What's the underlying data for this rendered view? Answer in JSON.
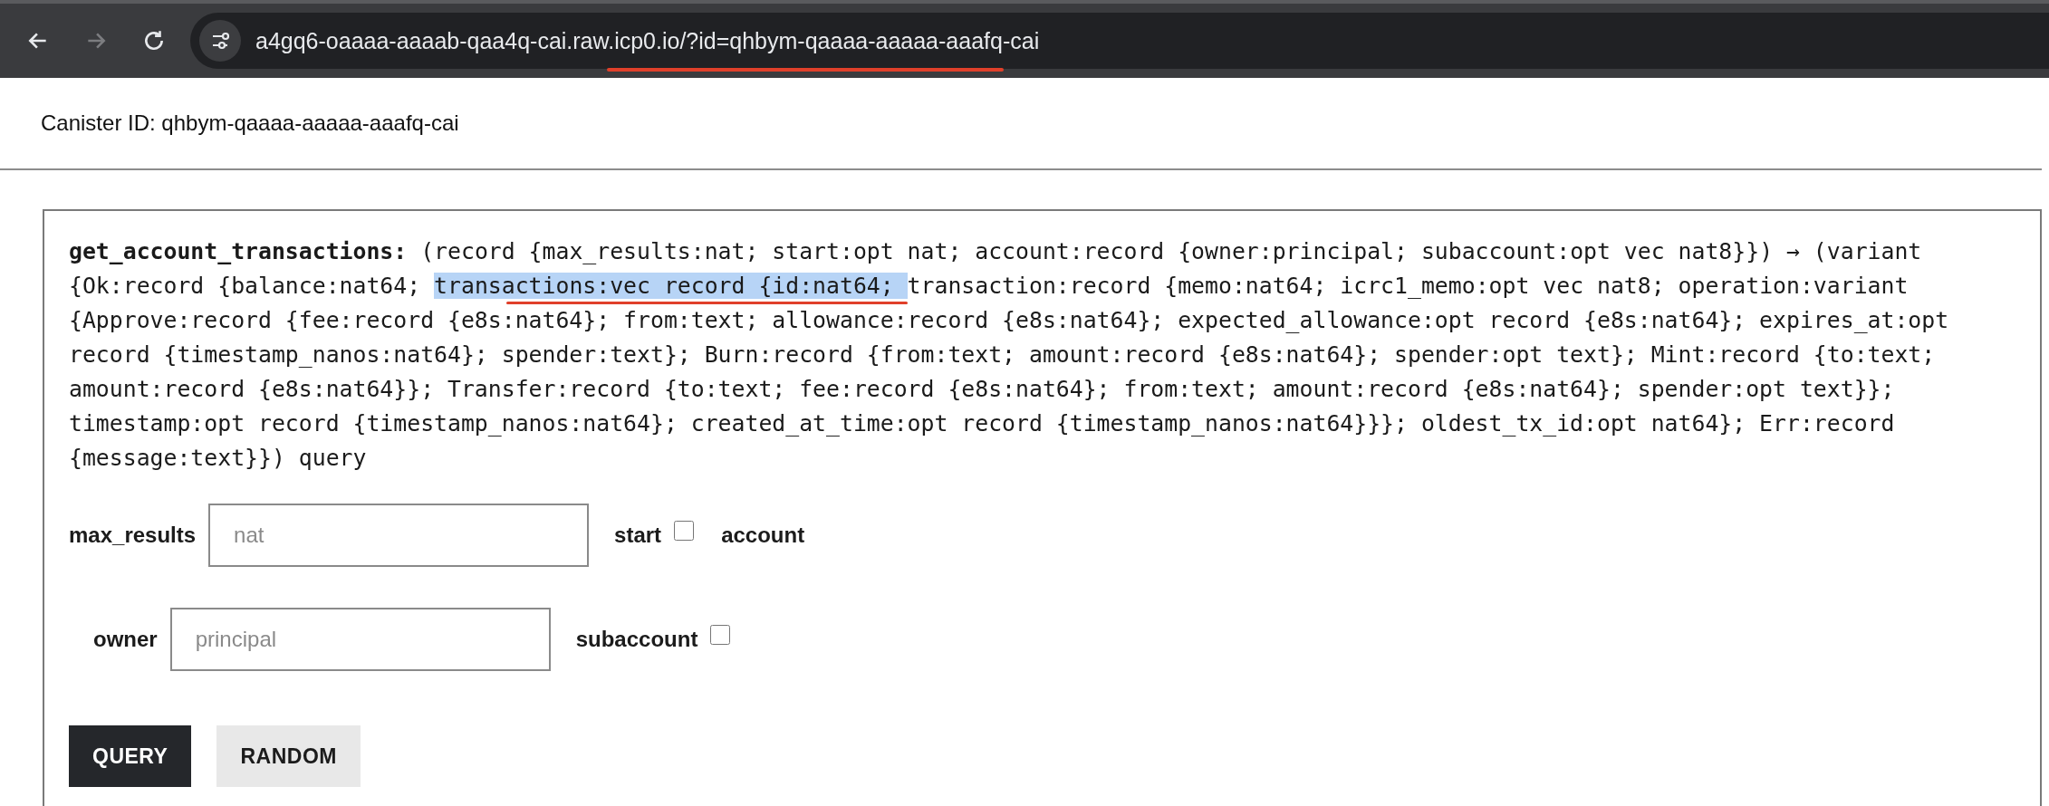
{
  "browser": {
    "nav": [
      {
        "kind": "back",
        "disabled": false
      },
      {
        "kind": "forward",
        "disabled": true
      },
      {
        "kind": "reload",
        "disabled": false
      }
    ],
    "url": "a4gq6-oaaaa-aaaab-qaa4q-cai.raw.icp0.io/?id=qhbym-qaaaa-aaaaa-aaafq-cai"
  },
  "canister_label": "Canister ID: qhbym-qaaaa-aaaaa-aaafq-cai",
  "method": {
    "name": "get_account_transactions:",
    "signature": [
      {
        "text": " (record {max_results:nat; start:opt nat; account:record {owner:principal; subaccount:opt vec nat8}}) → (variant {Ok:record {balance:nat64; ",
        "highlighted": false
      },
      {
        "text": "transactions:vec record {id:nat64; ",
        "highlighted": true
      },
      {
        "text": "transaction:record {memo:nat64; icrc1_memo:opt vec nat8; operation:variant {Approve:record {fee:record {e8s:nat64}; from:text; allowance:record {e8s:nat64}; expected_allowance:opt record {e8s:nat64}; expires_at:opt record {timestamp_nanos:nat64}; spender:text}; Burn:record {from:text; amount:record {e8s:nat64}; spender:opt text}; Mint:record {to:text; amount:record {e8s:nat64}}; Transfer:record {to:text; fee:record {e8s:nat64}; from:text; amount:record {e8s:nat64}; spender:opt text}}; timestamp:opt record {timestamp_nanos:nat64}; created_at_time:opt record {timestamp_nanos:nat64}}}; oldest_tx_id:opt nat64}; Err:record {message:text}}) query",
        "highlighted": false
      }
    ],
    "fields": [
      {
        "kind": "input",
        "label": "max_results",
        "placeholder": "nat"
      },
      {
        "kind": "checkbox",
        "label": "start",
        "checked": false
      },
      {
        "kind": "group",
        "label": "account",
        "children": [
          {
            "kind": "input",
            "label": "owner",
            "placeholder": "principal"
          },
          {
            "kind": "checkbox",
            "label": "subaccount",
            "checked": false
          }
        ]
      }
    ],
    "buttons": [
      {
        "label": "QUERY",
        "kind": "primary"
      },
      {
        "label": "RANDOM",
        "kind": "secondary"
      }
    ]
  }
}
